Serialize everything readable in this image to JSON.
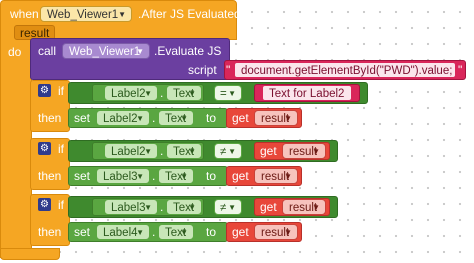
{
  "event": {
    "when": "when",
    "component": "Web_Viewer1",
    "event_name": ".After JS Evaluated",
    "param": "result",
    "do": "do"
  },
  "call": {
    "keyword": "call",
    "component": "Web_Viewer1",
    "method": ".Evaluate JS",
    "arg_label": "script",
    "script_value": "document.getElementById(\"PWD\").value;"
  },
  "blocks": [
    {
      "if_label": "if",
      "then_label": "then",
      "cond_component": "Label2",
      "cond_prop": "Text",
      "operator": "=",
      "cond_right_text": "Text for Label2",
      "set_label": "set",
      "set_component": "Label2",
      "set_prop": "Text",
      "to_label": "to",
      "get_label": "get",
      "get_var": "result"
    },
    {
      "if_label": "if",
      "then_label": "then",
      "cond_component": "Label2",
      "cond_prop": "Text",
      "operator": "≠",
      "cond_right_get": "get",
      "cond_right_var": "result",
      "set_label": "set",
      "set_component": "Label3",
      "set_prop": "Text",
      "to_label": "to",
      "get_label": "get",
      "get_var": "result"
    },
    {
      "if_label": "if",
      "then_label": "then",
      "cond_component": "Label3",
      "cond_prop": "Text",
      "operator": "≠",
      "cond_right_get": "get",
      "cond_right_var": "result",
      "set_label": "set",
      "set_component": "Label4",
      "set_prop": "Text",
      "to_label": "to",
      "get_label": "get",
      "get_var": "result"
    }
  ]
}
